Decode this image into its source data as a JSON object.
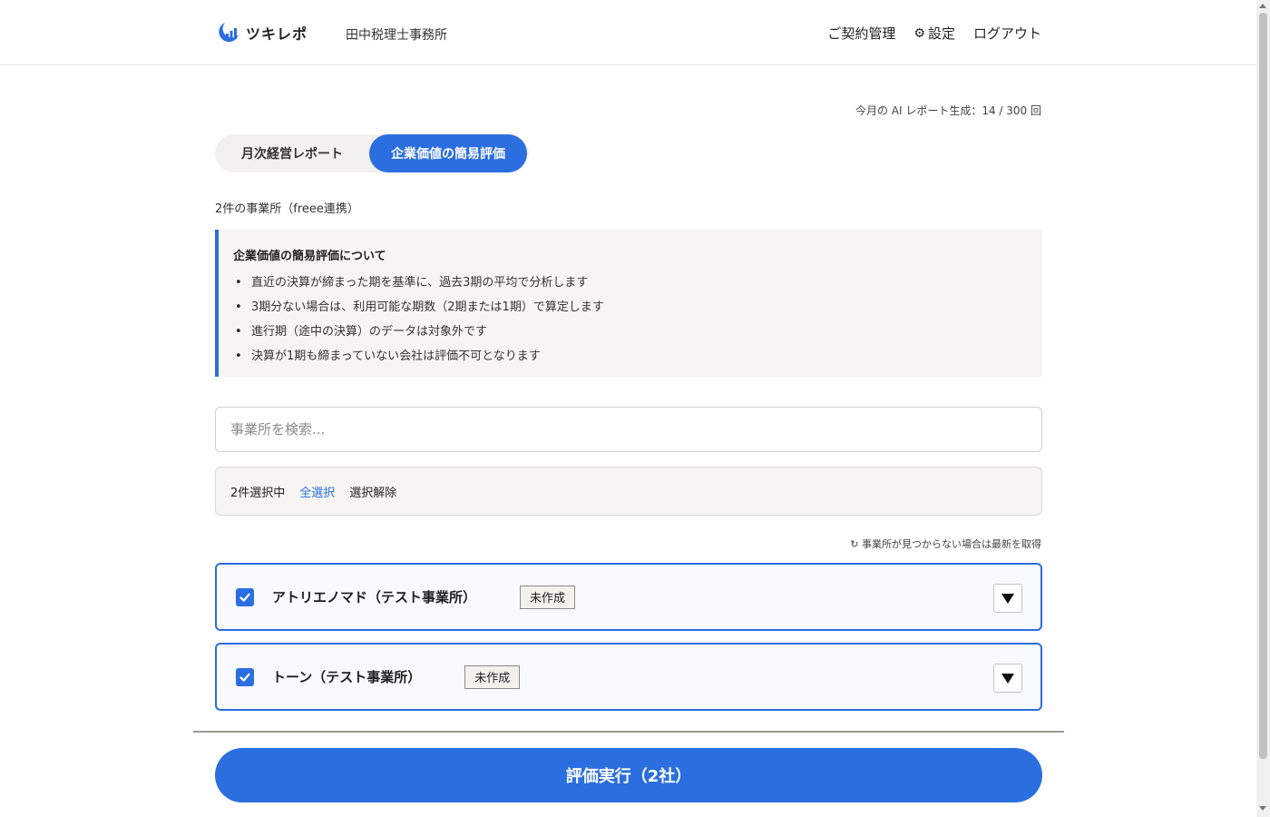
{
  "header": {
    "app_name": "ツキレポ",
    "office_name": "田中税理士事務所",
    "nav": {
      "contract": "ご契約管理",
      "settings": "設定",
      "logout": "ログアウト"
    }
  },
  "quota": "今月の AI レポート生成：14 / 300 回",
  "tabs": {
    "monthly": "月次経営レポート",
    "valuation": "企業価値の簡易評価",
    "active": "valuation"
  },
  "office_count_note": "2件の事業所（freee連携）",
  "info": {
    "title": "企業価値の簡易評価について",
    "items": [
      "直近の決算が締まった期を基準に、過去3期の平均で分析します",
      "3期分ない場合は、利用可能な期数（2期または1期）で算定します",
      "進行期（途中の決算）のデータは対象外です",
      "決算が1期も締まっていない会社は評価不可となります"
    ]
  },
  "search": {
    "placeholder": "事業所を検索...",
    "value": ""
  },
  "selection": {
    "count_text": "2件選択中",
    "select_all": "全選択",
    "deselect": "選択解除"
  },
  "refresh_link": "↻ 事業所が見つからない場合は最新を取得",
  "companies": [
    {
      "name": "アトリエノマド（テスト事業所）",
      "status": "未作成",
      "checked": true
    },
    {
      "name": "トーン（テスト事業所）",
      "status": "未作成",
      "checked": true
    }
  ],
  "run_button": "評価実行（2社）",
  "colors": {
    "accent": "#2b6ee0",
    "panel_bg": "#f6f5f1"
  }
}
